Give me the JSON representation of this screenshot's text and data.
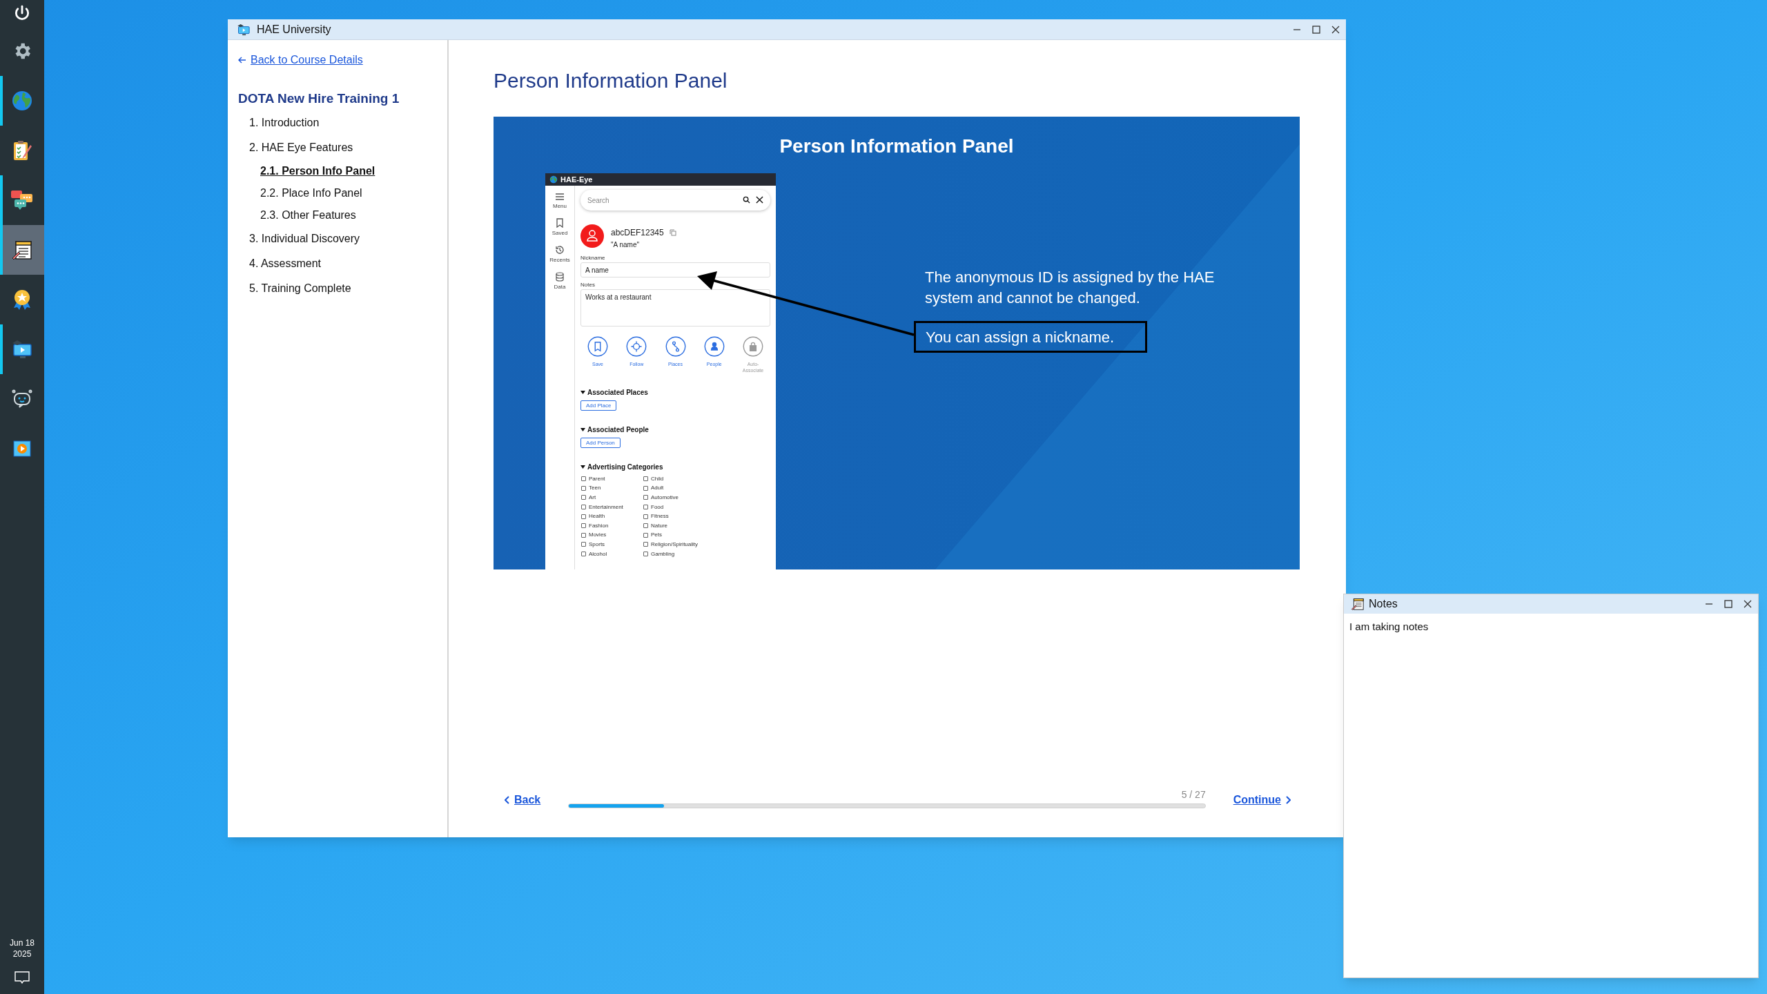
{
  "taskbar": {
    "items": [
      {
        "active": false,
        "selected": false
      },
      {
        "active": false,
        "selected": false
      },
      {
        "active": true,
        "selected": false
      },
      {
        "active": false,
        "selected": false
      },
      {
        "active": true,
        "selected": false
      },
      {
        "active": true,
        "selected": true
      },
      {
        "active": false,
        "selected": false
      },
      {
        "active": true,
        "selected": false
      },
      {
        "active": false,
        "selected": false
      },
      {
        "active": false,
        "selected": false
      }
    ],
    "date": "Jun 18",
    "year": "2025"
  },
  "window": {
    "title": "HAE University"
  },
  "sidebar": {
    "back_link": "Back to Course Details",
    "course_title": "DOTA New Hire Training 1",
    "items": [
      {
        "label": "1. Introduction",
        "selected": false
      },
      {
        "label": "2. HAE Eye Features",
        "selected": false,
        "children": [
          {
            "label": "2.1. Person Info Panel",
            "selected": true
          },
          {
            "label": "2.2. Place Info Panel",
            "selected": false
          },
          {
            "label": "2.3. Other Features",
            "selected": false
          }
        ]
      },
      {
        "label": "3. Individual Discovery",
        "selected": false
      },
      {
        "label": "4. Assessment",
        "selected": false
      },
      {
        "label": "5. Training Complete",
        "selected": false
      }
    ]
  },
  "page_title": "Person Information Panel",
  "slide": {
    "title": "Person Information Panel",
    "app": {
      "title": "HAE-Eye",
      "rail": [
        {
          "label": "Menu"
        },
        {
          "label": "Saved"
        },
        {
          "label": "Recents"
        },
        {
          "label": "Data"
        }
      ],
      "search_placeholder": "Search",
      "id": "abcDEF12345",
      "quoted_name": "\"A name\"",
      "nickname_label": "Nickname",
      "nickname": "A name",
      "notes_label": "Notes",
      "notes": "Works at a restaurant",
      "actions": [
        {
          "label": "Save",
          "disabled": false
        },
        {
          "label": "Follow",
          "disabled": false
        },
        {
          "label": "Places",
          "disabled": false
        },
        {
          "label": "People",
          "disabled": false
        },
        {
          "label": "Auto-Associate",
          "disabled": true
        }
      ],
      "places_heading": "Associated Places",
      "add_place": "Add Place",
      "people_heading": "Associated People",
      "add_person": "Add Person",
      "categories_heading": "Advertising Categories",
      "categories": [
        {
          "label": "Parent",
          "checked": false
        },
        {
          "label": "Child",
          "checked": false
        },
        {
          "label": "Teen",
          "checked": false
        },
        {
          "label": "Adult",
          "checked": false
        },
        {
          "label": "Art",
          "checked": false
        },
        {
          "label": "Automotive",
          "checked": false
        },
        {
          "label": "Entertainment",
          "checked": false
        },
        {
          "label": "Food",
          "checked": false
        },
        {
          "label": "Health",
          "checked": false
        },
        {
          "label": "Fitness",
          "checked": false
        },
        {
          "label": "Fashion",
          "checked": false
        },
        {
          "label": "Nature",
          "checked": false
        },
        {
          "label": "Movies",
          "checked": false
        },
        {
          "label": "Pets",
          "checked": false
        },
        {
          "label": "Sports",
          "checked": false
        },
        {
          "label": "Religion/Spirituality",
          "checked": false
        },
        {
          "label": "Alcohol",
          "checked": false
        },
        {
          "label": "Gambling",
          "checked": false
        }
      ]
    },
    "description": "The anonymous ID is assigned by the HAE system and cannot be changed.",
    "callout": "You can assign a nickname."
  },
  "navigation": {
    "back": "Back",
    "continue": "Continue",
    "count": "5 / 27",
    "level": 0.15
  },
  "notes_window": {
    "title": "Notes",
    "text": "I am taking notes"
  }
}
